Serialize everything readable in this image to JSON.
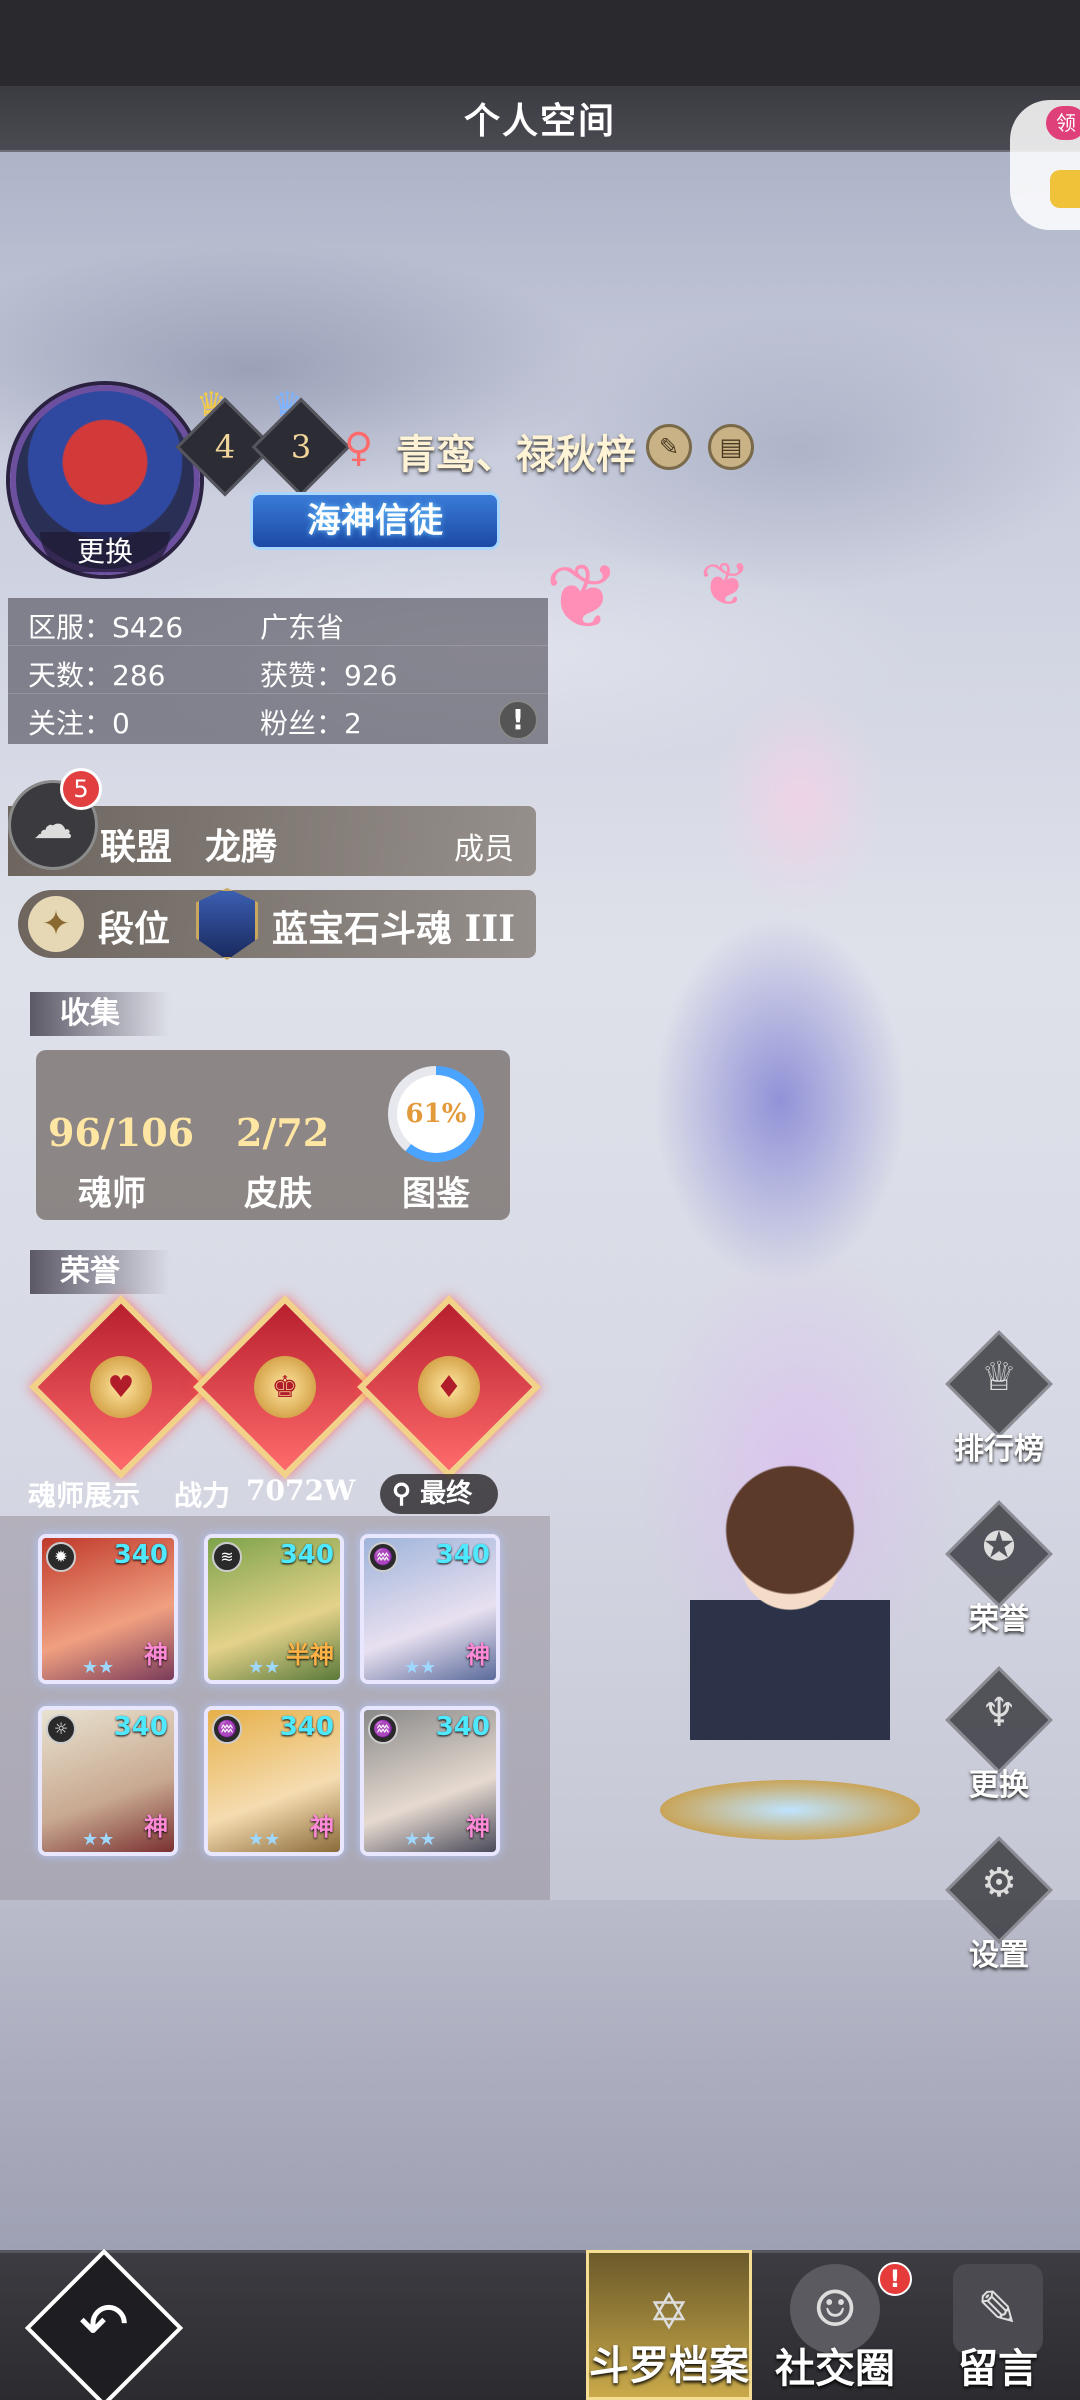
{
  "header": {
    "title": "个人空间"
  },
  "corner_widget": {
    "label": "领"
  },
  "profile": {
    "avatar_change_label": "更换",
    "rank_badges": [
      {
        "value": "4",
        "icon": "crown-gold-icon"
      },
      {
        "value": "3",
        "icon": "crown-blue-icon"
      }
    ],
    "gender_icon": "female-icon",
    "name": "青鸾、禄秋梓",
    "edit_icon": "pencil-icon",
    "notes_icon": "document-icon",
    "title_banner": "海神信徒"
  },
  "stats": {
    "server": "区服：S426",
    "province": "广东省",
    "days": "天数：286",
    "likes": "获赞：926",
    "following": "关注：0",
    "fans": "粉丝：2",
    "info_icon": "!"
  },
  "alliance": {
    "chat_badge": "5",
    "label": "联盟",
    "name": "龙腾",
    "role": "成员"
  },
  "rank": {
    "label": "段位",
    "name": "蓝宝石斗魂 III"
  },
  "collection": {
    "section_title": "收集",
    "items": [
      {
        "value": "96/106",
        "label": "魂师"
      },
      {
        "value": "2/72",
        "label": "皮肤"
      }
    ],
    "atlas": {
      "label": "图鉴",
      "percent_text": "61%",
      "percent": 0.61
    }
  },
  "honor": {
    "section_title": "荣誉",
    "badges": [
      "heart-emblem-icon",
      "crown-emblem-icon",
      "flame-emblem-icon"
    ]
  },
  "showcase": {
    "title": "魂师展示",
    "power_label": "战力",
    "power_value": "7072W",
    "search_label": "最终",
    "heroes": [
      {
        "level": "340",
        "tag": "神",
        "element": "fire-icon"
      },
      {
        "level": "340",
        "tag": "半神",
        "element": "wind-icon"
      },
      {
        "level": "340",
        "tag": "神",
        "element": "water-icon"
      },
      {
        "level": "340",
        "tag": "神",
        "element": "light-icon"
      },
      {
        "level": "340",
        "tag": "神",
        "element": "water-icon"
      },
      {
        "level": "340",
        "tag": "神",
        "element": "water-icon"
      }
    ]
  },
  "side_buttons": [
    {
      "label": "排行榜",
      "icon": "trophy-icon"
    },
    {
      "label": "荣誉",
      "icon": "medal-icon"
    },
    {
      "label": "更换",
      "icon": "trident-icon"
    },
    {
      "label": "设置",
      "icon": "gear-icon"
    }
  ],
  "bottom_tabs": [
    {
      "label": "斗罗档案",
      "icon": "hexagram-book-icon",
      "active": true
    },
    {
      "label": "社交圈",
      "icon": "people-icon",
      "alert": "!"
    },
    {
      "label": "留言",
      "icon": "edit-note-icon"
    }
  ],
  "colors": {
    "accent_gold": "#f5dd93",
    "level_cyan": "#4ee8ff",
    "alert_red": "#e53b3b",
    "banner_blue": "#1c4aa5"
  }
}
